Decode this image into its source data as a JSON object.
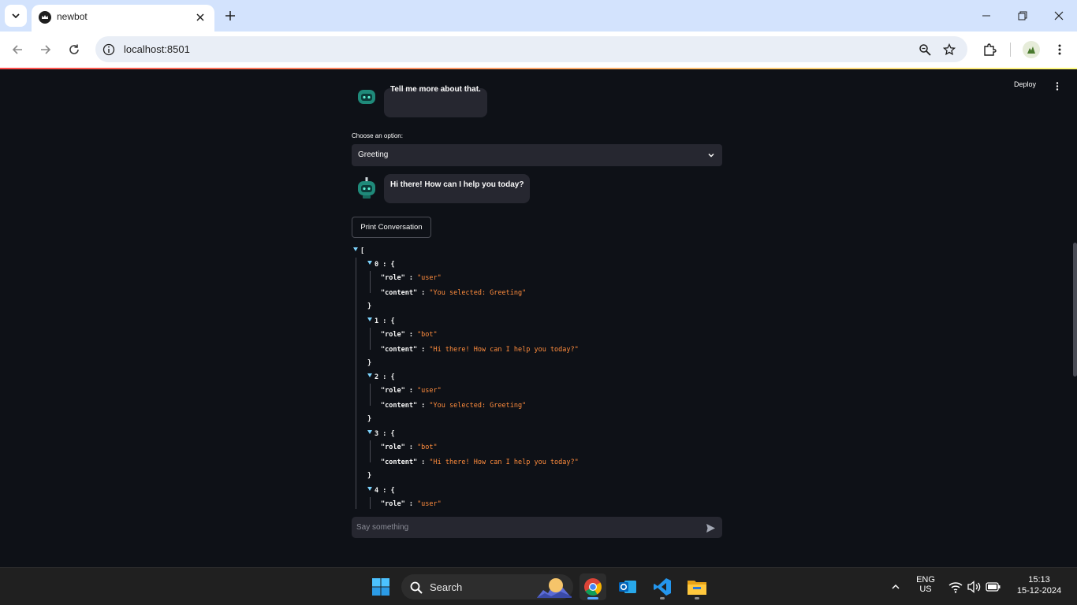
{
  "browser": {
    "tab_title": "newbot",
    "url": "localhost:8501"
  },
  "app": {
    "deploy_label": "Deploy",
    "previous_message": "Tell me more about that.",
    "option_label": "Choose an option:",
    "selected_option": "Greeting",
    "bot_reply": "Hi there! How can I help you today?",
    "print_button": "Print Conversation",
    "json_view": {
      "entries": [
        {
          "index": "0",
          "role": "\"user\"",
          "content": "\"You selected: Greeting\""
        },
        {
          "index": "1",
          "role": "\"bot\"",
          "content": "\"Hi there! How can I help you today?\""
        },
        {
          "index": "2",
          "role": "\"user\"",
          "content": "\"You selected: Greeting\""
        },
        {
          "index": "3",
          "role": "\"bot\"",
          "content": "\"Hi there! How can I help you today?\""
        },
        {
          "index": "4",
          "role": "\"user\""
        }
      ]
    },
    "chat_input_placeholder": "Say something"
  },
  "taskbar": {
    "search_label": "Search",
    "lang_primary": "ENG",
    "lang_secondary": "US",
    "time": "15:13",
    "date": "15-12-2024"
  },
  "icons": {
    "tab_menu": "chevron-down-icon",
    "favicon": "crown-icon",
    "back": "arrow-left-icon",
    "forward": "arrow-right-icon",
    "reload": "reload-icon",
    "site_info": "info-icon",
    "zoom": "magnifier-icon",
    "bookmark": "star-icon",
    "extensions": "puzzle-icon",
    "send": "send-icon"
  },
  "colors": {
    "app_background": "#0e1117",
    "surface": "#262730",
    "json_string": "#ff8c3d",
    "json_toggle": "#7dd3fc",
    "browser_frame": "#d3e3fd"
  }
}
